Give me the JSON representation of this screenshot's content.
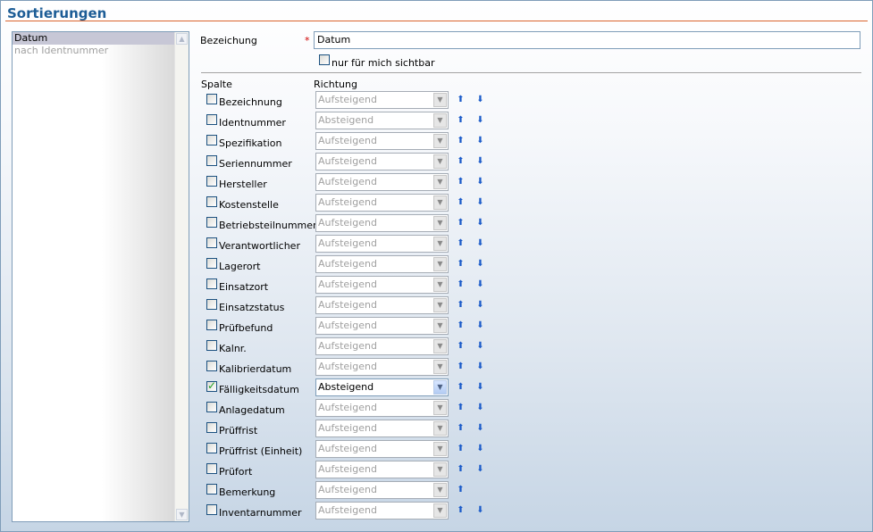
{
  "title": "Sortierungen",
  "list": {
    "items": [
      {
        "label": "Datum",
        "selected": true
      },
      {
        "label": "nach Identnummer",
        "selected": false
      }
    ]
  },
  "form": {
    "name_label": "Bezeichung",
    "required_mark": "*",
    "name_value": "Datum",
    "private_label": "nur für mich sichtbar",
    "private_checked": false,
    "col_header": "Spalte",
    "dir_header": "Richtung"
  },
  "rows": [
    {
      "label": "Bezeichnung",
      "checked": false,
      "direction": "Aufsteigend",
      "active": false
    },
    {
      "label": "Identnummer",
      "checked": false,
      "direction": "Absteigend",
      "active": false
    },
    {
      "label": "Spezifikation",
      "checked": false,
      "direction": "Aufsteigend",
      "active": false
    },
    {
      "label": "Seriennummer",
      "checked": false,
      "direction": "Aufsteigend",
      "active": false
    },
    {
      "label": "Hersteller",
      "checked": false,
      "direction": "Aufsteigend",
      "active": false
    },
    {
      "label": "Kostenstelle",
      "checked": false,
      "direction": "Aufsteigend",
      "active": false
    },
    {
      "label": "Betriebsteilnummer",
      "checked": false,
      "direction": "Aufsteigend",
      "active": false
    },
    {
      "label": "Verantwortlicher",
      "checked": false,
      "direction": "Aufsteigend",
      "active": false
    },
    {
      "label": "Lagerort",
      "checked": false,
      "direction": "Aufsteigend",
      "active": false
    },
    {
      "label": "Einsatzort",
      "checked": false,
      "direction": "Aufsteigend",
      "active": false
    },
    {
      "label": "Einsatzstatus",
      "checked": false,
      "direction": "Aufsteigend",
      "active": false
    },
    {
      "label": "Prüfbefund",
      "checked": false,
      "direction": "Aufsteigend",
      "active": false
    },
    {
      "label": "Kalnr.",
      "checked": false,
      "direction": "Aufsteigend",
      "active": false
    },
    {
      "label": "Kalibrierdatum",
      "checked": false,
      "direction": "Aufsteigend",
      "active": false
    },
    {
      "label": "Fälligkeitsdatum",
      "checked": true,
      "direction": "Absteigend",
      "active": true
    },
    {
      "label": "Anlagedatum",
      "checked": false,
      "direction": "Aufsteigend",
      "active": false
    },
    {
      "label": "Prüffrist",
      "checked": false,
      "direction": "Aufsteigend",
      "active": false
    },
    {
      "label": "Prüffrist (Einheit)",
      "checked": false,
      "direction": "Aufsteigend",
      "active": false
    },
    {
      "label": "Prüfort",
      "checked": false,
      "direction": "Aufsteigend",
      "active": false
    },
    {
      "label": "Bemerkung",
      "checked": false,
      "direction": "Aufsteigend",
      "active": false,
      "no_down": true
    },
    {
      "label": "Inventarnummer",
      "checked": false,
      "direction": "Aufsteigend",
      "active": false
    }
  ],
  "icons": {
    "move_up": "arrow-up-icon",
    "move_down": "arrow-down-icon",
    "dropdown": "chevron-down-icon"
  }
}
